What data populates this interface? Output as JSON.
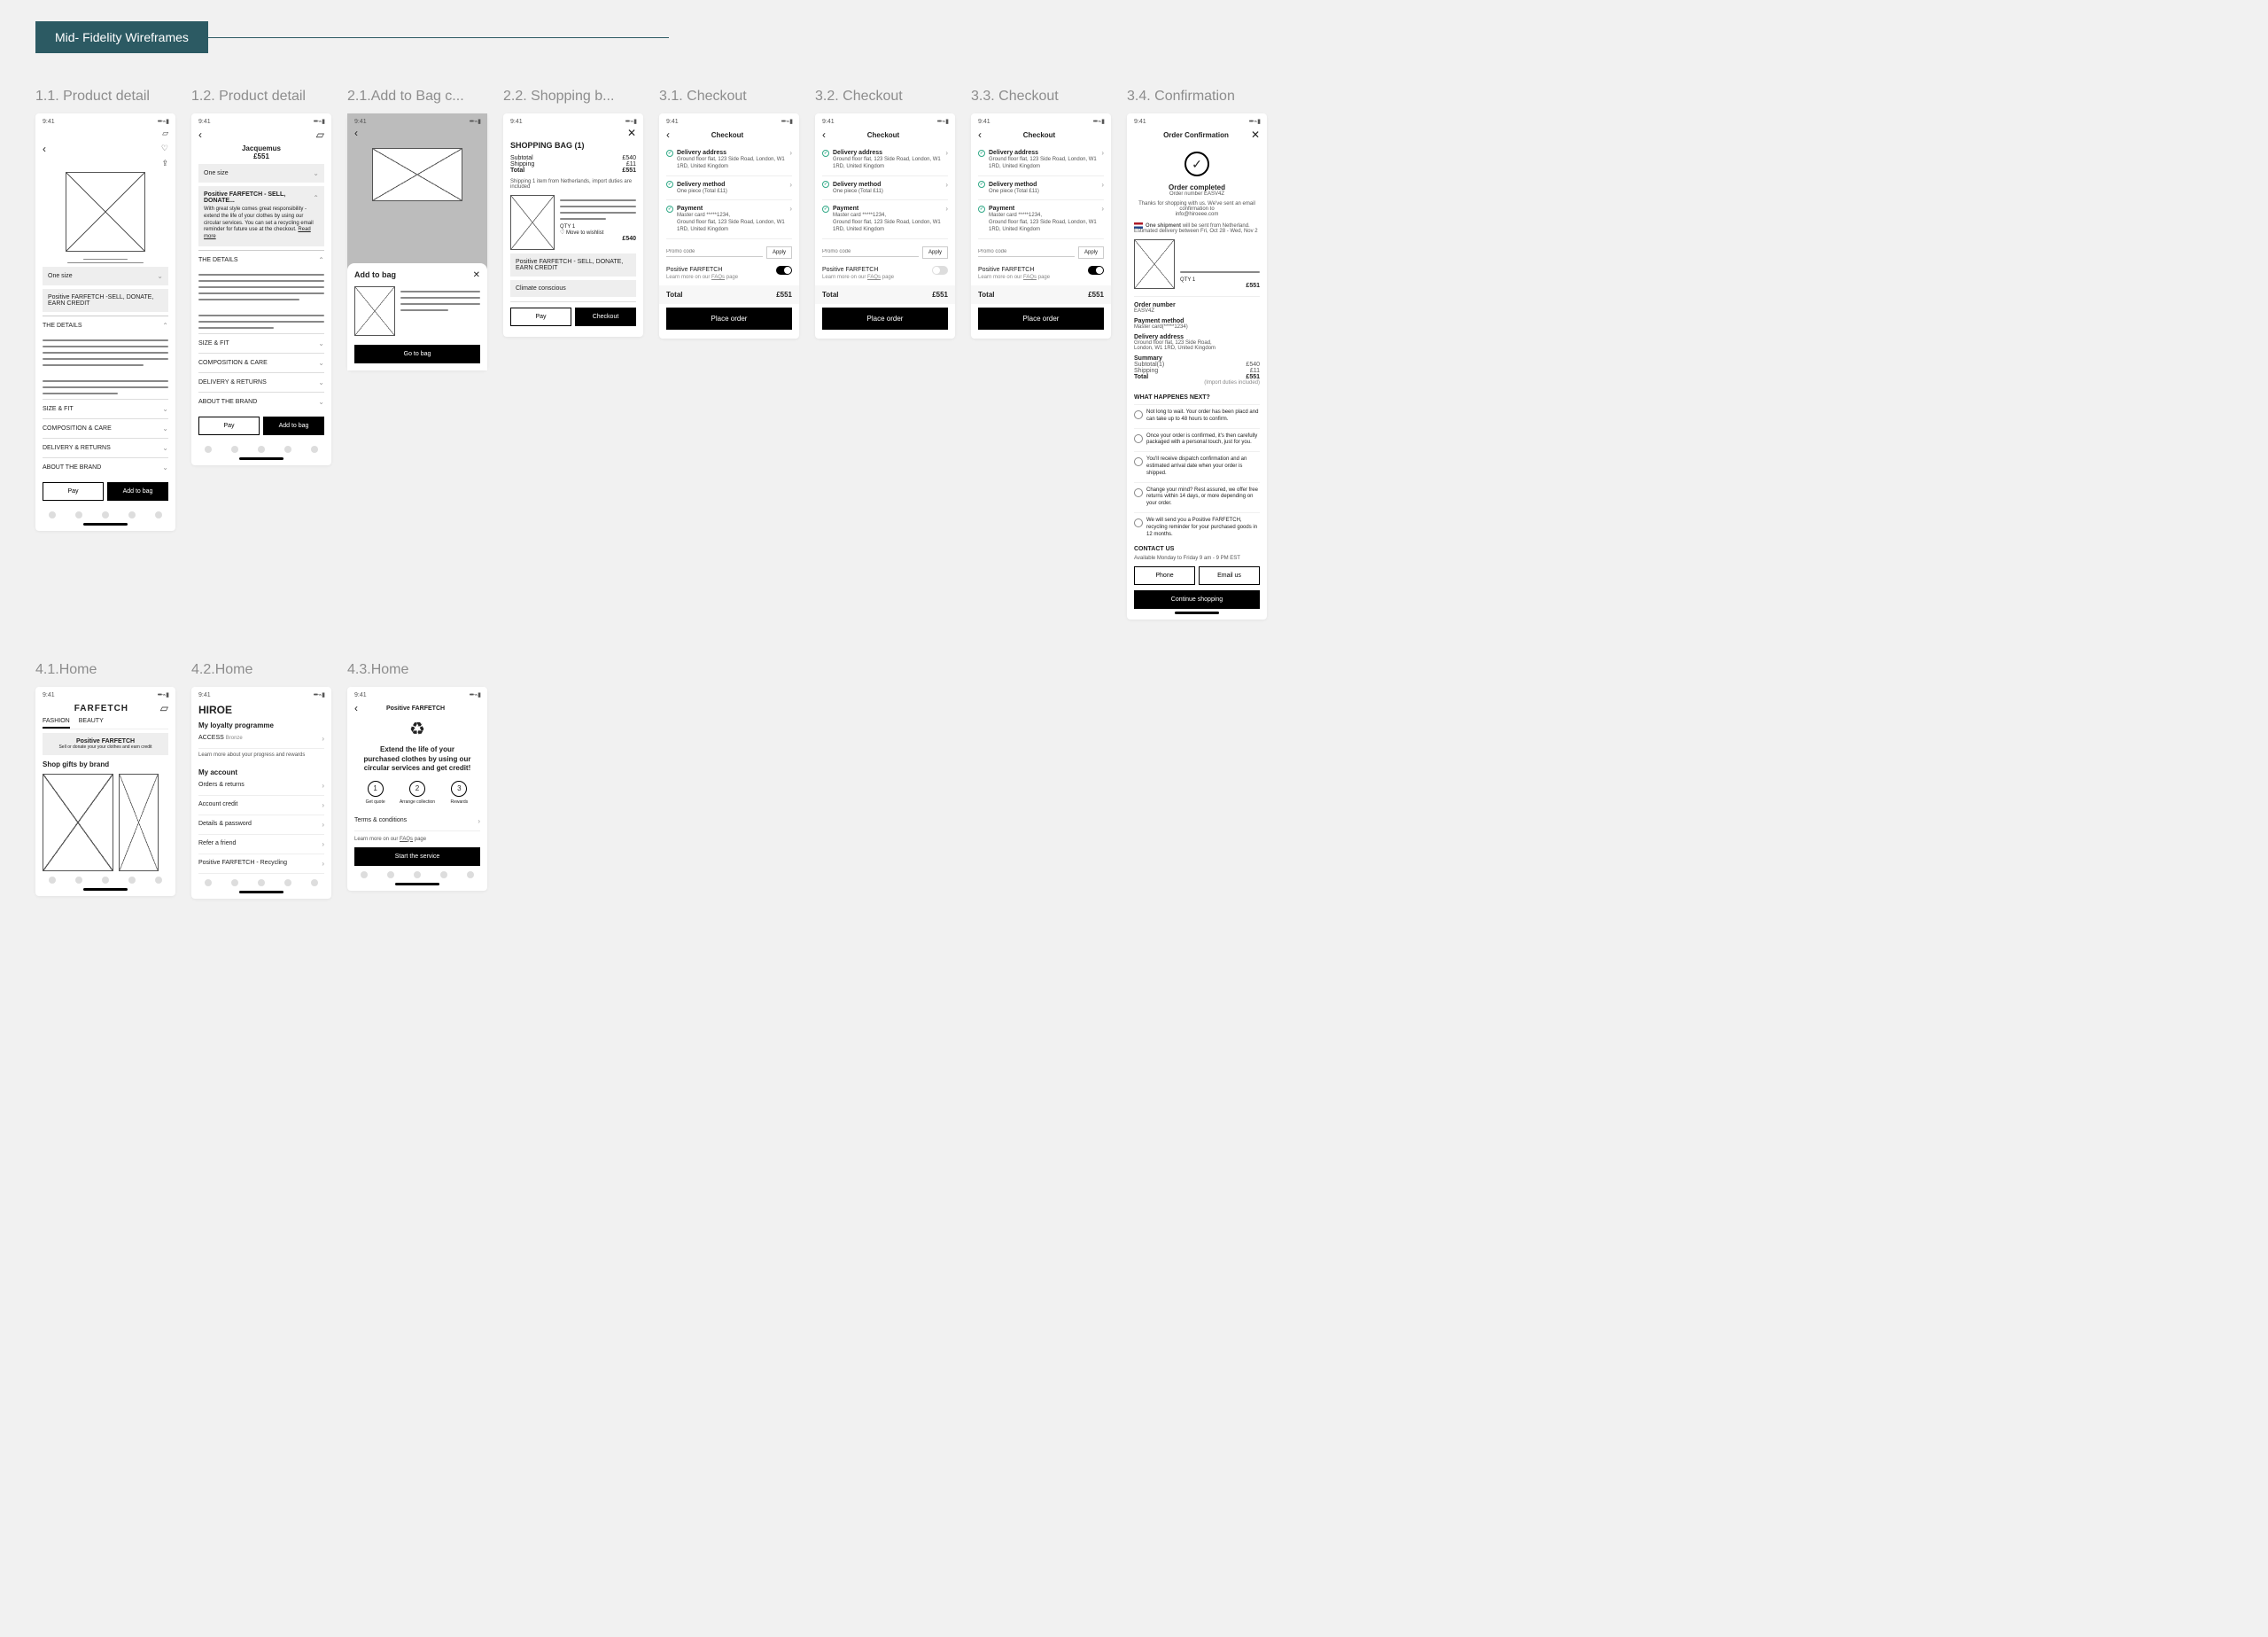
{
  "header": {
    "tab": "Mid- Fidelity Wireframes"
  },
  "labels": {
    "s11": "1.1. Product detail",
    "s12": "1.2. Product detail",
    "s21": "2.1.Add to Bag c...",
    "s22": "2.2. Shopping b...",
    "s31": "3.1. Checkout",
    "s32": "3.2. Checkout",
    "s33": "3.3. Checkout",
    "s34": "3.4. Confirmation",
    "s41": "4.1.Home",
    "s42": "4.2.Home",
    "s43": "4.3.Home"
  },
  "common": {
    "time": "9:41",
    "one_size": "One size",
    "apple_pay": "Pay",
    "add_to_bag": "Add to bag",
    "go_to_bag": "Go to bag",
    "positive_pill": "Positive FARFETCH -SELL, DONATE, EARN CREDIT",
    "positive_pill2": "Positive FARFETCH - SELL, DONATE...",
    "positive_sell": "Positive FARFETCH - SELL, DONATE, EARN CREDIT",
    "details": "THE DETAILS",
    "size_fit": "SIZE & FIT",
    "comp_care": "COMPOSITION & CARE",
    "delivery_returns": "DELIVERY & RETURNS",
    "about_brand": "ABOUT THE BRAND"
  },
  "pdp2": {
    "brand": "Jacquemus",
    "price": "£551",
    "copy": "With great style comes great responsibility - extend the life of your clothes by using our circular services. You can set a recycling email reminder for future use at the checkout.",
    "readmore": "Read more"
  },
  "addmodal": {
    "title": "Add to bag"
  },
  "bag": {
    "title": "SHOPPING BAG (1)",
    "subtotal_l": "Subtotal",
    "subtotal_v": "£540",
    "shipping_l": "Shipping",
    "shipping_v": "£11",
    "total_l": "Total",
    "total_v": "£551",
    "ship_note": "Shipping 1 item from Netherlands, import duties are included",
    "qty": "QTY 1",
    "wishlist": "Move to wishlist",
    "price": "£540",
    "climate": "Climate conscious",
    "checkout": "Checkout"
  },
  "checkout": {
    "title": "Checkout",
    "addr_h": "Delivery address",
    "addr": "Ground floor flat, 123 Side Road, London, W1 1RD, United Kingdom",
    "method_h": "Delivery method",
    "method_v": "One piece (Total £11)",
    "pay_h": "Payment",
    "card": "Master card *****1234,",
    "promo_ph": "Promo code",
    "apply": "Apply",
    "pf": "Positive FARFETCH",
    "learn": "Learn more on our",
    "faqs": "FAQs",
    "page": "page",
    "total": "Total",
    "total_v": "£551",
    "place": "Place order"
  },
  "conf": {
    "title": "Order Confirmation",
    "completed": "Order completed",
    "ordnum": "Order number EASV4Z",
    "thanks": "Thanks for shopping with us. We've sent an email confirmation to",
    "email": "info@hiroeee.com",
    "ship_bold": "One shipment",
    "ship_rest": "will be sent from Netherland. Estimated delivery between Fri, Oct 28 - Wed, Nov 2",
    "qty": "QTY 1",
    "price": "£551",
    "on_h": "Order number",
    "on_v": "EASV4Z",
    "pm_h": "Payment method",
    "pm_v": "Master card(*****1234)",
    "da_h": "Delivery address",
    "addr1": "Ground floor flat, 123 Side Road,",
    "addr2": "London, W1 1RD, United Kingdom",
    "sum_h": "Summary",
    "sub_l": "Subtotal(1)",
    "sub_v": "£540",
    "ship_l": "Shipping",
    "ship_v": "£11",
    "tot_l": "Total",
    "tot_v": "£551",
    "duties": "(Import duties included)",
    "wn_h": "WHAT HAPPENES NEXT?",
    "wn1": "Not long to wait. Your order has been placd and can take up to 48 hours to confirm.",
    "wn2": "Once your order is confirmed, it's then carefully packaged with a personal touch, just for you.",
    "wn3": "You'll receive dispatch confirmation and an estimated arrival date when your order is shipped.",
    "wn4": "Change your mind? Rest assured, we offer free returns within 14 days, or more depending on your order.",
    "wn5": "We will send you a Positive FARFETCH, recycling reminder for your purchased goods in 12 months.",
    "contact_h": "CONTACT US",
    "contact_sub": "Available Monday to Friday 9 am - 9 PM EST",
    "phone": "Phone",
    "emailus": "Email us",
    "continue": "Continue shopping"
  },
  "home1": {
    "brand": "FARFETCH",
    "tab1": "FASHION",
    "tab2": "BEAUTY",
    "pf": "Positive FARFETCH",
    "sub": "Sell or donate your your clothes and earn credit",
    "shop": "Shop gifts by brand"
  },
  "home2": {
    "name": "HIROE",
    "loyalty": "My loyalty programme",
    "access": "ACCESS",
    "tier": "Bronze",
    "learn": "Learn more about your progress and rewards",
    "account": "My account",
    "m1": "Orders & returns",
    "m2": "Account credit",
    "m3": "Details & password",
    "m4": "Refer a friend",
    "m5": "Positive FARFETCH - Recycling"
  },
  "home3": {
    "brand": "Positive FARFETCH",
    "copy": "Extend the life of your purchased clothes by using our circular services and get credit!",
    "s1": "1",
    "s1l": "Get quote",
    "s2": "2",
    "s2l": "Arrange collection",
    "s3": "3",
    "s3l": "Rewards",
    "terms": "Terms & conditions",
    "learn": "Learn more on our",
    "faqs": "FAQs",
    "page": "page",
    "start": "Start the service"
  }
}
